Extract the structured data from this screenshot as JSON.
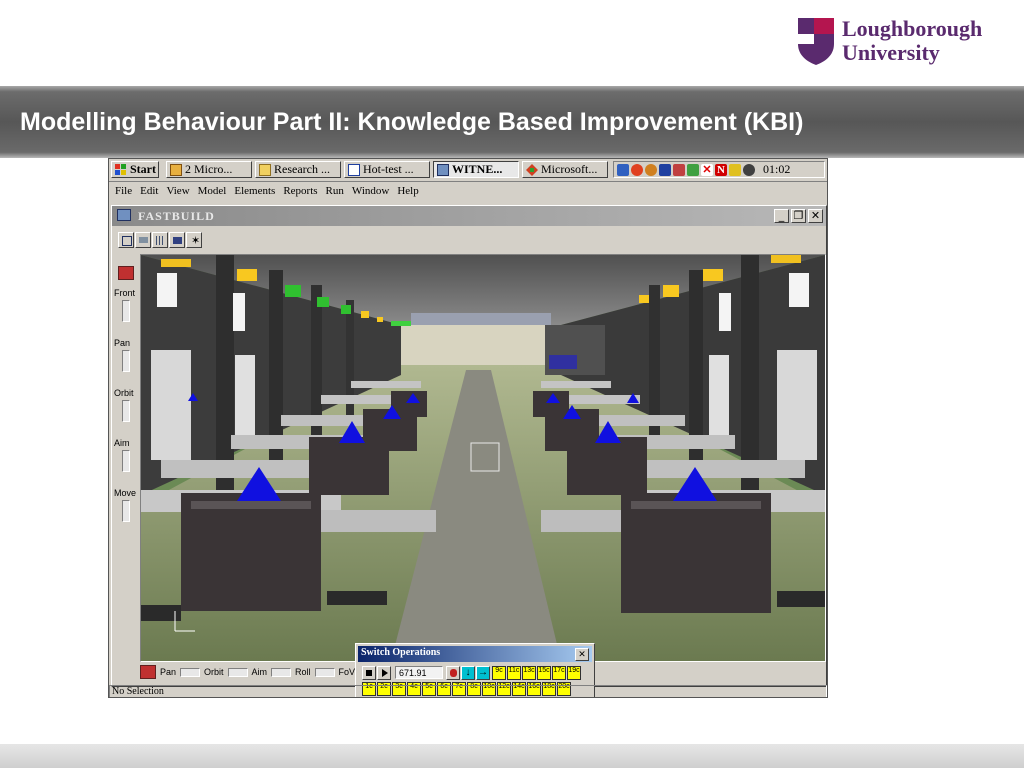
{
  "slide": {
    "title": "Modelling Behaviour Part II: Knowledge Based Improvement (KBI)",
    "logo": {
      "line1": "Loughborough",
      "line2": "University"
    },
    "colors": {
      "title_band": "#575757",
      "logo_purple": "#5a2a6e",
      "logo_red": "#b4154f"
    }
  },
  "taskbar": {
    "start_label": "Start",
    "buttons": [
      {
        "label": "2 Micro...",
        "icon": "windows-group-icon"
      },
      {
        "label": "Research ...",
        "icon": "folder-icon"
      },
      {
        "label": "Hot-test ...",
        "icon": "document-icon"
      },
      {
        "label": "WITNE...",
        "icon": "witness-app-icon",
        "active": true
      },
      {
        "label": "Microsoft...",
        "icon": "microsoft-office-icon"
      }
    ],
    "tray_icons": [
      "network-icon",
      "antivirus-icon",
      "volume-icon",
      "sync-icon",
      "security-icon",
      "close-red-icon",
      "printer-icon",
      "norton-icon",
      "pen-icon",
      "webcam-icon"
    ],
    "clock": "01:02"
  },
  "menubar": {
    "items": [
      "File",
      "Edit",
      "View",
      "Model",
      "Elements",
      "Reports",
      "Run",
      "Window",
      "Help"
    ]
  },
  "child_window": {
    "title": "FASTBUILD",
    "minimize": "_",
    "restore": "❐",
    "close": "✕"
  },
  "side_controls": [
    "Front",
    "Pan",
    "Orbit",
    "Aim",
    "Move"
  ],
  "bottom_toolbar": [
    "Pan",
    "Orbit",
    "Aim",
    "Roll",
    "FoV"
  ],
  "switch_dialog": {
    "title": "Switch Operations",
    "time": "671.91",
    "close": "✕",
    "top_buttons": [
      "9c",
      "11c",
      "13c",
      "15c",
      "17c",
      "19c"
    ],
    "bottom_buttons": [
      "1c",
      "2c",
      "3c",
      "4c",
      "5c",
      "6c",
      "7c",
      "8c",
      "10c",
      "12c",
      "14c",
      "16c",
      "18c",
      "20c"
    ]
  },
  "status": {
    "text": "No Selection"
  }
}
